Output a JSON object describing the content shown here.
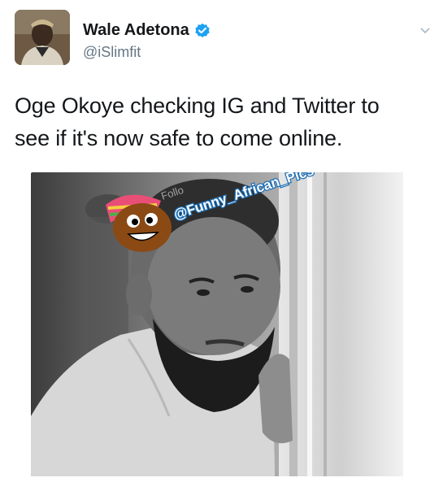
{
  "tweet": {
    "display_name": "Wale Adetona",
    "handle": "@iSlimfit",
    "text": "Oge Okoye checking IG and Twitter to see if it's now safe to come online.",
    "verified": true
  },
  "icons": {
    "verified": "verified-badge-icon",
    "menu": "chevron-down-icon"
  },
  "photo": {
    "watermark": "@Funny_African_Pics",
    "watermark_ghost": "Follo"
  },
  "colors": {
    "verified_blue": "#1da1f2",
    "handle_gray": "#657786",
    "watermark_blue": "#1e6fb5"
  }
}
